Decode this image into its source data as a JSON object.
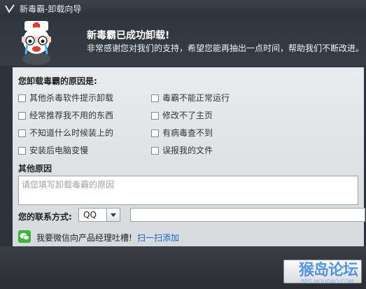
{
  "window": {
    "title": "新毒霸-卸载向导"
  },
  "header": {
    "success": "新毒霸已成功卸载!",
    "thanks": "非常感谢您对我们的支持，希望您能再抽出一点时间，帮助我们不断改进。"
  },
  "reasons": {
    "title": "您卸载毒霸的原因是:",
    "left": [
      "其他杀毒软件提示卸载",
      "经常推荐我不用的东西",
      "不知道什么时候装上的",
      "安装后电脑变慢"
    ],
    "right": [
      "毒霸不能正常运行",
      "修改不了主页",
      "有病毒查不到",
      "误报我的文件"
    ]
  },
  "other": {
    "title": "其他原因",
    "placeholder": "请您填写卸载毒霸的原因"
  },
  "contact": {
    "label": "您的联系方式:",
    "type": "QQ",
    "value": ""
  },
  "wechat": {
    "text": "我要微信向产品经理吐槽!",
    "link": "扫一扫添加"
  },
  "submit": {
    "label": ""
  },
  "watermark": {
    "text": "猴岛论坛",
    "sub": "BBS.HOUDAO.COM"
  }
}
